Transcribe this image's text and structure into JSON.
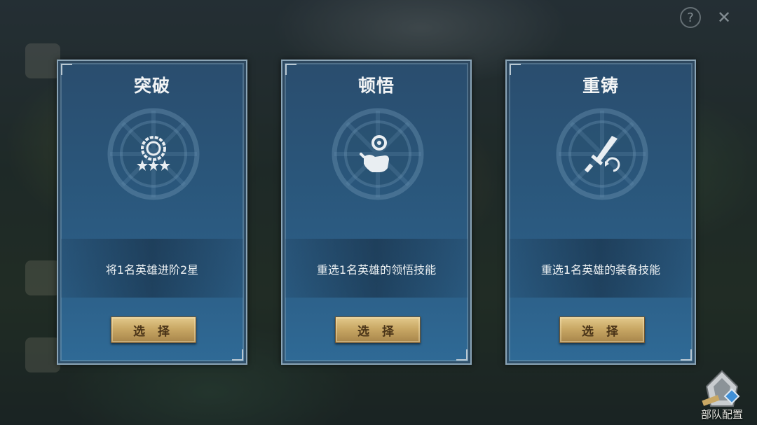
{
  "header": {
    "title": "",
    "help_icon": "question-icon",
    "close_icon": "close-icon"
  },
  "colors": {
    "card_blue": "#2c5e86",
    "button_gold": "#c9a865",
    "title_white": "#f2f4f5"
  },
  "cards": [
    {
      "title": "突破",
      "icon": "medal-stars-icon",
      "description": "将1名英雄进阶2星",
      "button_label": "选 择"
    },
    {
      "title": "顿悟",
      "icon": "hand-orb-icon",
      "description": "重选1名英雄的领悟技能",
      "button_label": "选 择"
    },
    {
      "title": "重铸",
      "icon": "sword-refresh-icon",
      "description": "重选1名英雄的装备技能",
      "button_label": "选 择"
    }
  ],
  "team_config": {
    "label": "部队配置",
    "icon": "team-config-icon"
  }
}
